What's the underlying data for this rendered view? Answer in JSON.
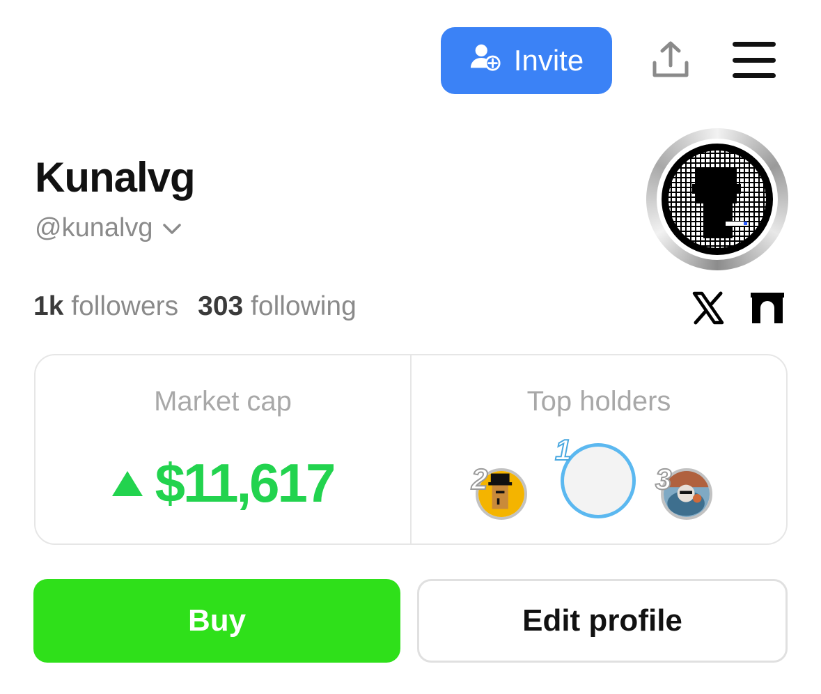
{
  "header": {
    "invite_label": "Invite",
    "invite_icon": "user-plus-icon",
    "share_icon": "share-upload-icon",
    "menu_icon": "hamburger-menu-icon",
    "accent_color": "#3b82f6"
  },
  "profile": {
    "display_name": "Kunalvg",
    "handle": "@kunalvg",
    "avatar_icon": "pixel-portrait-avatar",
    "followers_count": "1k",
    "followers_label": "followers",
    "following_count": "303",
    "following_label": "following",
    "social_links": [
      {
        "icon": "x-logo-icon"
      },
      {
        "icon": "gate-logo-icon"
      }
    ]
  },
  "stats": {
    "market_cap_label": "Market cap",
    "market_cap_value": "$11,617",
    "market_cap_trend": "up",
    "market_cap_color": "#22d34e",
    "top_holders_label": "Top holders",
    "top_holders": [
      {
        "rank": "2",
        "avatar": "punk-top-hat-avatar"
      },
      {
        "rank": "1",
        "avatar": "empty-avatar"
      },
      {
        "rank": "3",
        "avatar": "photo-avatar"
      }
    ]
  },
  "actions": {
    "buy_label": "Buy",
    "buy_color": "#2fe01a",
    "edit_label": "Edit profile"
  }
}
